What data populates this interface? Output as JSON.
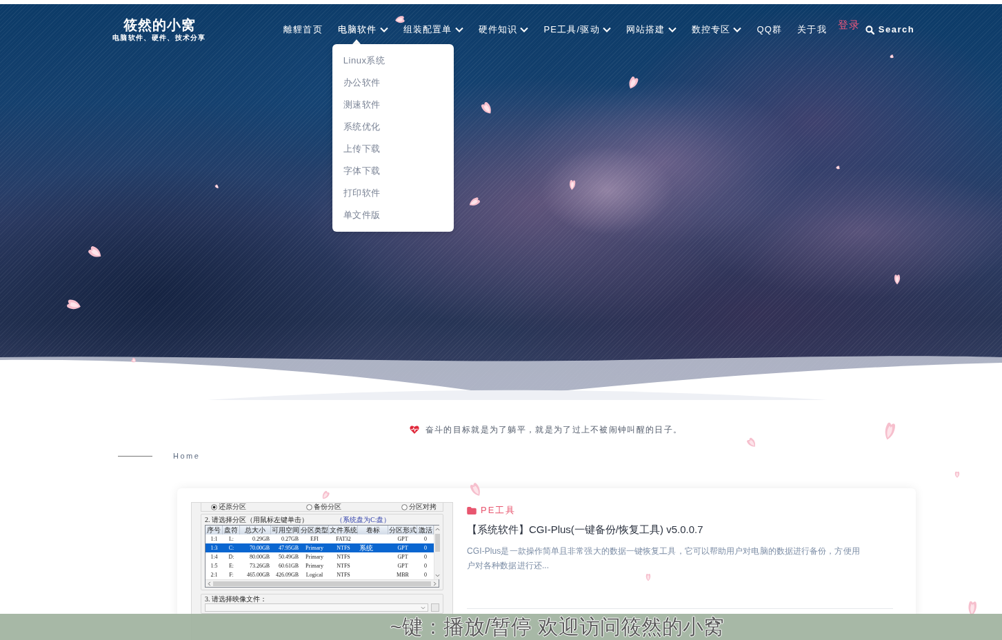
{
  "header": {
    "logo": {
      "title": "筱然的小窝",
      "subtitle": "电脑软件、硬件、技术分享"
    },
    "nav": [
      {
        "kind": "link",
        "label": "離貍首页",
        "dropdown": false,
        "expanded": false
      },
      {
        "kind": "link",
        "label": "电脑软件",
        "dropdown": true,
        "expanded": true,
        "menu": [
          "Linux系统",
          "办公软件",
          "测速软件",
          "系统优化",
          "上传下载",
          "字体下载",
          "打印软件",
          "单文件版"
        ]
      },
      {
        "kind": "link",
        "label": "组装配置单",
        "dropdown": true,
        "expanded": false
      },
      {
        "kind": "link",
        "label": "硬件知识",
        "dropdown": true,
        "expanded": false
      },
      {
        "kind": "link",
        "label": "PE工具/驱动",
        "dropdown": true,
        "expanded": false
      },
      {
        "kind": "link",
        "label": "网站搭建",
        "dropdown": true,
        "expanded": false
      },
      {
        "kind": "link",
        "label": "数控专区",
        "dropdown": true,
        "expanded": false
      },
      {
        "kind": "link",
        "label": "QQ群",
        "dropdown": false,
        "expanded": false
      },
      {
        "kind": "link",
        "label": "关于我",
        "dropdown": false,
        "expanded": false
      },
      {
        "kind": "login",
        "label": "登录",
        "dropdown": false,
        "expanded": false
      },
      {
        "kind": "search",
        "label": "Search",
        "dropdown": false,
        "expanded": false
      }
    ]
  },
  "motto": "奋斗的目标就是为了躺平，就是为了过上不被闹钟叫醒的日子。",
  "breadcrumb": [
    "Home"
  ],
  "posts": [
    {
      "category": "PE工具",
      "title": "【系统软件】CGI-Plus(一键备份/恢复工具) v5.0.0.7",
      "excerpt": "CGI-Plus是一款操作简单且非常强大的数据一键恢复工具，它可以帮助用户对电脑的数据进行备份，方便用户对各种数据进行还...",
      "thumbnail": {
        "options": [
          {
            "label": "还原分区",
            "selected": true
          },
          {
            "label": "备份分区",
            "selected": false
          },
          {
            "label": "分区对拷",
            "selected": false
          }
        ],
        "partition_group": {
          "title": "2. 请选择分区（用鼠标左键单击）",
          "note": "（系统盘为C:盘）"
        },
        "table": {
          "columns": [
            "序号",
            "盘符",
            "总大小",
            "可用空间",
            "分区类型",
            "文件系统",
            "卷标",
            "分区形式",
            "激活"
          ],
          "rows": [
            {
              "number": "1:1",
              "drive": "L:",
              "total_size": "0.29GB",
              "free_space": "0.27GB",
              "partition_type": "EFI",
              "file_system": "FAT32",
              "partition_style": "GPT",
              "active": "0",
              "selected": false
            },
            {
              "number": "1:3",
              "drive": "C:",
              "total_size": "70.00GB",
              "free_space": "47.95GB",
              "partition_type": "Primary",
              "file_system": "NTFS",
              "volume_label": "系统",
              "partition_style": "GPT",
              "active": "0",
              "selected": true
            },
            {
              "number": "1:4",
              "drive": "D:",
              "total_size": "80.00GB",
              "free_space": "50.49GB",
              "partition_type": "Primary",
              "file_system": "NTFS",
              "partition_style": "GPT",
              "active": "0",
              "selected": false
            },
            {
              "number": "1:5",
              "drive": "E:",
              "total_size": "73.26GB",
              "free_space": "60.61GB",
              "partition_type": "Primary",
              "file_system": "NTFS",
              "partition_style": "GPT",
              "active": "0",
              "selected": false
            },
            {
              "number": "2:1",
              "drive": "F:",
              "total_size": "465.00GB",
              "free_space": "426.09GB",
              "partition_type": "Logical",
              "file_system": "NTFS",
              "partition_style": "MBR",
              "active": "0",
              "selected": false
            }
          ]
        },
        "image_group": {
          "title": "3. 请选择映像文件："
        }
      }
    }
  ],
  "player_bar": {
    "text": "~键：播放/暂停 欢迎访问筱然的小窝"
  }
}
